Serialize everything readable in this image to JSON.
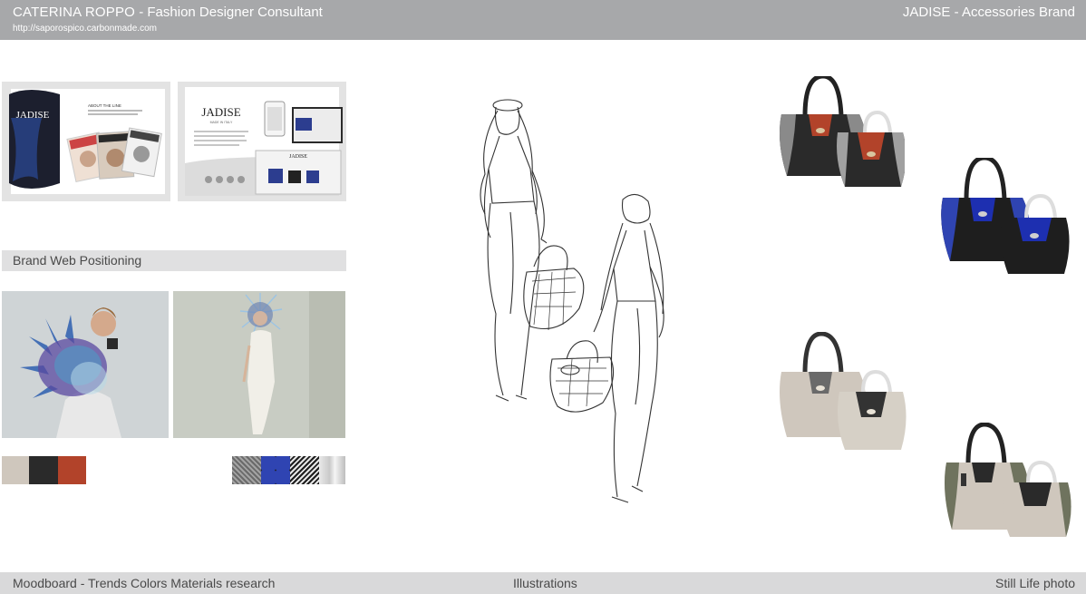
{
  "header": {
    "designer_name": "CATERINA ROPPO",
    "separator": " - ",
    "designer_role": "Fashion Designer Consultant",
    "url": "http://saporospico.carbonmade.com",
    "brand_name": "JADISE",
    "brand_separator": " - ",
    "brand_desc": "Accessories Brand"
  },
  "web_positioning": {
    "label": "Brand Web Positioning",
    "print_logo": "JADISE",
    "print_heading": "ABOUT THE LINE",
    "web_logo": "JADISE",
    "web_subtitle": "MADE IN ITALY",
    "web_site_logo": "JADISE"
  },
  "moodboard": {
    "swatch_colors": [
      "#cfc7bd",
      "#2a2a2a",
      "#b2432a"
    ]
  },
  "footer": {
    "left": "Moodboard - Trends Colors Materials research",
    "center": "Illustrations",
    "right": "Still Life photo"
  },
  "colors": {
    "header_bg": "#a7a8aa",
    "label_bg": "#e0e0e1",
    "footer_bg": "#d9d9da",
    "bag_red": "#b2432a",
    "bag_blue": "#1d2fb0",
    "bag_black": "#252525",
    "bag_taupe": "#cfc7bd",
    "bag_olive": "#6f735e"
  },
  "icons": [
    "bag-icon",
    "fashion-sketch-icon",
    "magazine-icon",
    "laptop-icon",
    "phone-icon"
  ]
}
